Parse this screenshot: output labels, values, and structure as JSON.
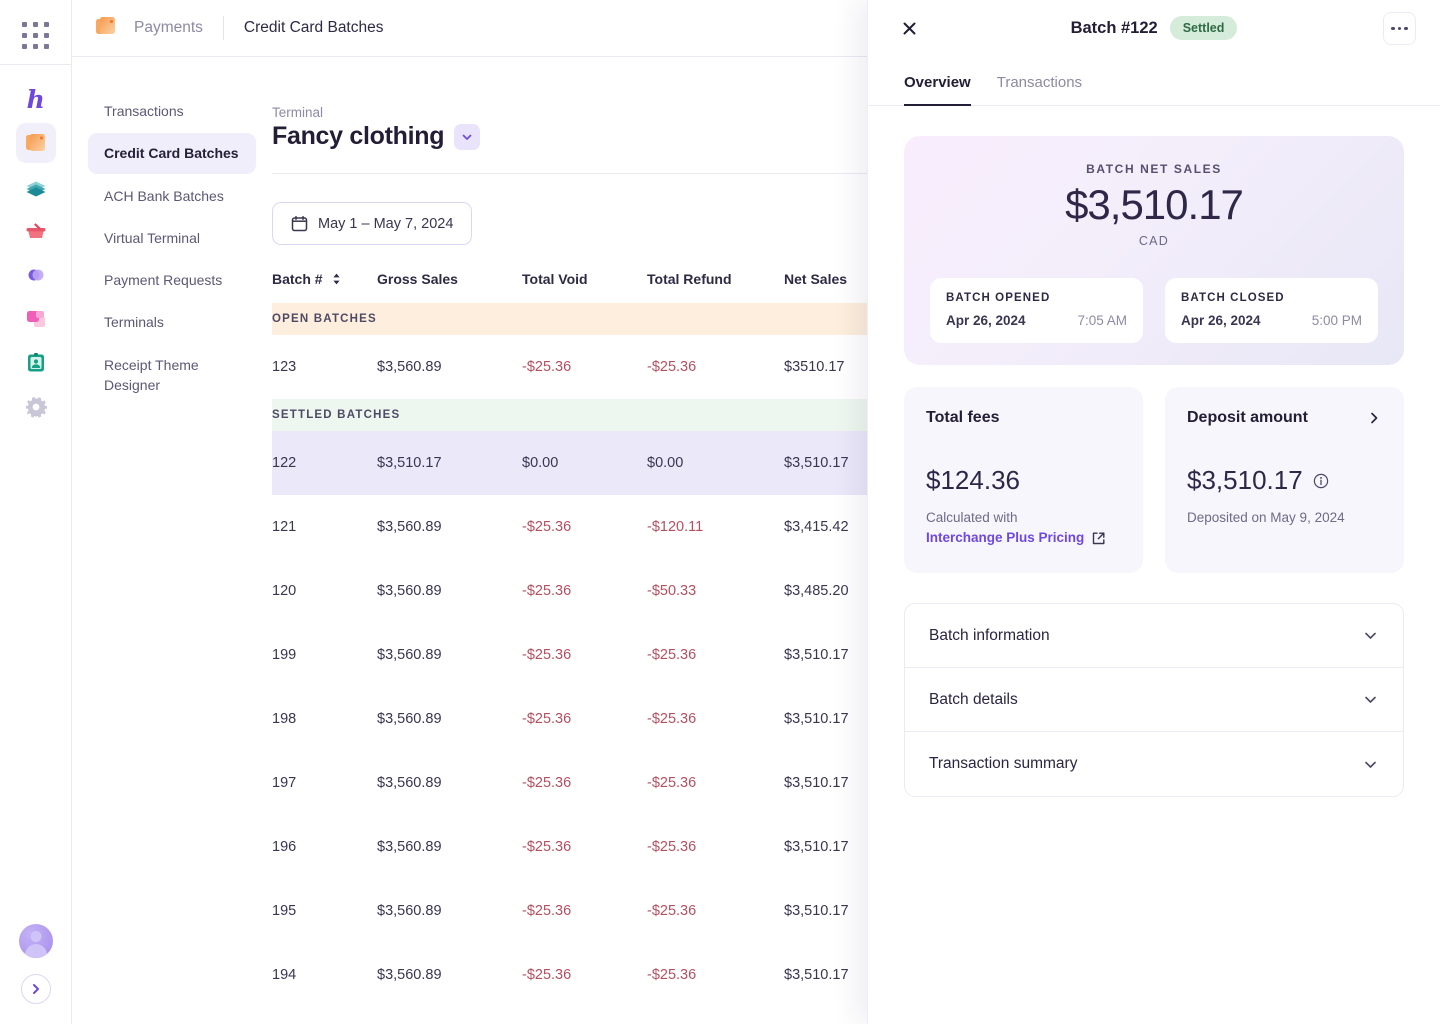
{
  "rail": {
    "apps_icon": "apps-grid-icon",
    "logo": "h",
    "items": [
      {
        "name": "payments",
        "icon": "payments-card-icon",
        "active": true
      },
      {
        "name": "layers",
        "icon": "layers-icon",
        "active": false
      },
      {
        "name": "commerce",
        "icon": "basket-icon",
        "active": false
      },
      {
        "name": "insights",
        "icon": "circles-icon",
        "active": false
      },
      {
        "name": "marketing",
        "icon": "squares-icon",
        "active": false
      },
      {
        "name": "contacts",
        "icon": "id-card-icon",
        "active": false
      },
      {
        "name": "settings",
        "icon": "gear-icon",
        "active": false
      }
    ],
    "avatar": "user-avatar",
    "expand": "chevron-right-icon"
  },
  "topbar": {
    "app_icon": "payments-card-icon",
    "parent": "Payments",
    "current": "Credit Card Batches"
  },
  "subnav": {
    "items": [
      {
        "label": "Transactions",
        "active": false
      },
      {
        "label": "Credit Card Batches",
        "active": true
      },
      {
        "label": "ACH Bank Batches",
        "active": false
      },
      {
        "label": "Virtual Terminal",
        "active": false
      },
      {
        "label": "Payment Requests",
        "active": false
      },
      {
        "label": "Terminals",
        "active": false
      },
      {
        "label": "Receipt Theme Designer",
        "active": false
      }
    ]
  },
  "main": {
    "terminal_label": "Terminal",
    "terminal_name": "Fancy clothing",
    "date_range": "May 1 – May 7, 2024",
    "table": {
      "columns": [
        "Batch #",
        "Gross Sales",
        "Total Void",
        "Total Refund",
        "Net Sales"
      ],
      "groups": [
        {
          "label": "OPEN BATCHES",
          "kind": "open",
          "rows": [
            {
              "batch": "123",
              "gross": "$3,560.89",
              "void": "-$25.36",
              "refund": "-$25.36",
              "net": "$3510.17",
              "selected": false
            }
          ]
        },
        {
          "label": "SETTLED BATCHES",
          "kind": "settled",
          "rows": [
            {
              "batch": "122",
              "gross": "$3,510.17",
              "void": "$0.00",
              "refund": "$0.00",
              "net": "$3,510.17",
              "selected": true
            },
            {
              "batch": "121",
              "gross": "$3,560.89",
              "void": "-$25.36",
              "refund": "-$120.11",
              "net": "$3,415.42",
              "selected": false
            },
            {
              "batch": "120",
              "gross": "$3,560.89",
              "void": "-$25.36",
              "refund": "-$50.33",
              "net": "$3,485.20",
              "selected": false
            },
            {
              "batch": "199",
              "gross": "$3,560.89",
              "void": "-$25.36",
              "refund": "-$25.36",
              "net": "$3,510.17",
              "selected": false
            },
            {
              "batch": "198",
              "gross": "$3,560.89",
              "void": "-$25.36",
              "refund": "-$25.36",
              "net": "$3,510.17",
              "selected": false
            },
            {
              "batch": "197",
              "gross": "$3,560.89",
              "void": "-$25.36",
              "refund": "-$25.36",
              "net": "$3,510.17",
              "selected": false
            },
            {
              "batch": "196",
              "gross": "$3,560.89",
              "void": "-$25.36",
              "refund": "-$25.36",
              "net": "$3,510.17",
              "selected": false
            },
            {
              "batch": "195",
              "gross": "$3,560.89",
              "void": "-$25.36",
              "refund": "-$25.36",
              "net": "$3,510.17",
              "selected": false
            },
            {
              "batch": "194",
              "gross": "$3,560.89",
              "void": "-$25.36",
              "refund": "-$25.36",
              "net": "$3,510.17",
              "selected": false
            }
          ]
        }
      ]
    }
  },
  "drawer": {
    "close_icon": "close-icon",
    "title": "Batch #122",
    "status": "Settled",
    "more_icon": "kebab-menu-icon",
    "tabs": [
      {
        "label": "Overview",
        "active": true
      },
      {
        "label": "Transactions",
        "active": false
      }
    ],
    "hero": {
      "label": "BATCH NET SALES",
      "amount": "$3,510.17",
      "currency": "CAD",
      "opened": {
        "label": "BATCH OPENED",
        "date": "Apr 26, 2024",
        "time": "7:05 AM"
      },
      "closed": {
        "label": "BATCH CLOSED",
        "date": "Apr 26, 2024",
        "time": "5:00 PM"
      }
    },
    "fees": {
      "title": "Total fees",
      "amount": "$124.36",
      "sub": "Calculated with",
      "link": "Interchange Plus Pricing",
      "link_icon": "external-link-icon"
    },
    "deposit": {
      "title": "Deposit amount",
      "chevron_icon": "chevron-right-icon",
      "amount": "$3,510.17",
      "info_icon": "info-icon",
      "sub": "Deposited on May 9, 2024"
    },
    "accordion": [
      {
        "label": "Batch information"
      },
      {
        "label": "Batch details"
      },
      {
        "label": "Transaction summary"
      }
    ]
  },
  "colors": {
    "accent": "#6f48e0",
    "selected_row": "#ebe8fa",
    "open_group": "#fdeedd",
    "settled_group": "#eef7ef",
    "negative": "#b4505e",
    "badge_bg": "#d5ecda",
    "badge_text": "#2f6b42"
  }
}
